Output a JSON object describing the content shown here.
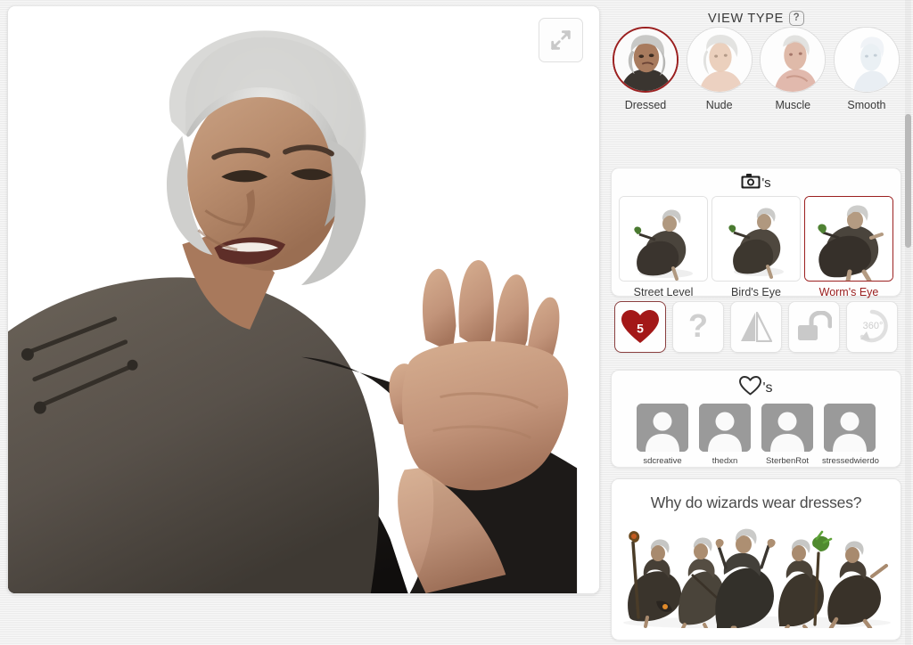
{
  "viewport": {
    "fullscreen_button": "fullscreen-expand",
    "figure_alt": "Elderly white-haired wizard character in grey robe raising hand"
  },
  "view_type": {
    "title": "VIEW TYPE",
    "help": "?",
    "options": [
      {
        "label": "Dressed",
        "selected": true
      },
      {
        "label": "Nude",
        "selected": false
      },
      {
        "label": "Muscle",
        "selected": false
      },
      {
        "label": "Smooth",
        "selected": false
      }
    ]
  },
  "cameras": {
    "title_suffix": "'s",
    "title_icon": "camera-icon",
    "options": [
      {
        "label": "Street Level",
        "selected": false
      },
      {
        "label": "Bird's Eye",
        "selected": false
      },
      {
        "label": "Worm's Eye",
        "selected": true
      }
    ]
  },
  "actions": [
    {
      "name": "favorite-button",
      "icon": "heart-icon",
      "count": "5",
      "selected": true
    },
    {
      "name": "help-button",
      "icon": "question-mark-icon",
      "count": "",
      "selected": false
    },
    {
      "name": "mirror-button",
      "icon": "mirror-flip-icon",
      "count": "",
      "selected": false
    },
    {
      "name": "unlock-button",
      "icon": "unlocked-padlock-icon",
      "count": "",
      "selected": false
    },
    {
      "name": "rotate-360-button",
      "icon": "rotate-360-icon",
      "count": "360°",
      "selected": false
    }
  ],
  "likes": {
    "title_suffix": "'s",
    "title_icon": "heart-outline-icon",
    "users": [
      {
        "name": "sdcreative"
      },
      {
        "name": "thedxn"
      },
      {
        "name": "SterbenRot"
      },
      {
        "name": "stressedwierdo"
      }
    ]
  },
  "promo": {
    "title": "Why do wizards wear dresses?"
  },
  "colors": {
    "accent_red": "#9b2020",
    "heart_red": "#a31818",
    "page_bg": "#f0f0f0",
    "panel_bg": "#fefefe",
    "text": "#3a3a3a",
    "icon_gray": "#c9c9c9"
  }
}
